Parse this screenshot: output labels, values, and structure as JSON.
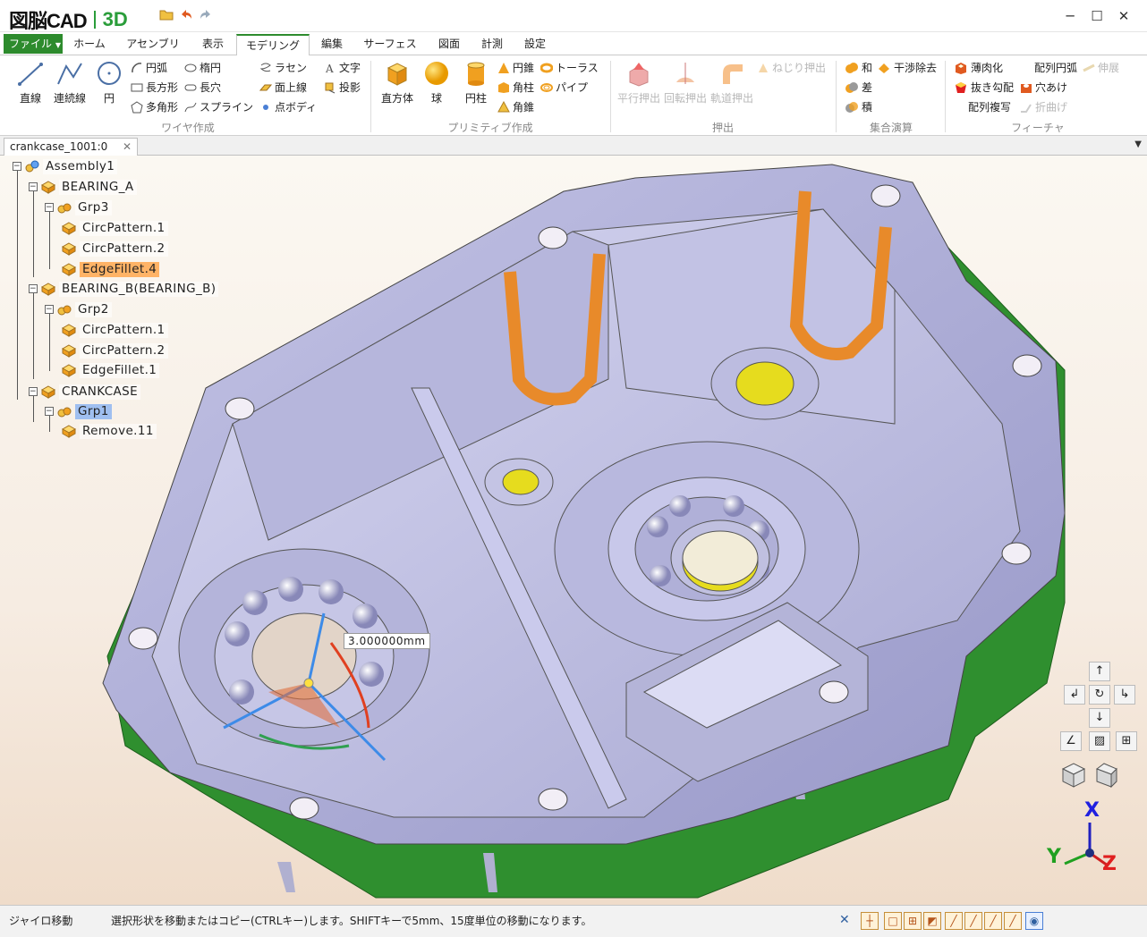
{
  "app": {
    "logo_text": "図脳CAD",
    "logo_3d": "3D"
  },
  "window_controls": {
    "minimize": "─",
    "maximize": "☐",
    "close": "✕"
  },
  "menu": {
    "file": "ファイル",
    "tabs": [
      "ホーム",
      "アセンブリ",
      "表示",
      "モデリング",
      "編集",
      "サーフェス",
      "図面",
      "計測",
      "設定"
    ],
    "active_tab": "モデリング"
  },
  "ribbon": {
    "wire": {
      "label": "ワイヤ作成",
      "line": "直線",
      "polyline": "連続線",
      "circle": "円",
      "arc": "円弧",
      "rectangle": "長方形",
      "polygon": "多角形",
      "ellipse": "楕円",
      "slot": "長穴",
      "spline": "スプライン",
      "helix": "ラセン",
      "surface_line": "面上線",
      "point_body": "点ボディ",
      "text": "文字",
      "projection": "投影"
    },
    "primitive": {
      "label": "プリミティブ作成",
      "box": "直方体",
      "sphere": "球",
      "cylinder": "円柱",
      "cone": "円錐",
      "prism": "角柱",
      "pyramid": "角錐",
      "torus": "トーラス",
      "pipe": "パイプ"
    },
    "extrude": {
      "label": "押出",
      "parallel": "平行押出",
      "revolve": "回転押出",
      "sweep": "軌道押出",
      "twist": "ねじり押出"
    },
    "boolean": {
      "label": "集合演算",
      "union": "和",
      "subtract": "差",
      "intersect": "積",
      "interference": "干渉除去"
    },
    "feature": {
      "label": "フィーチャ",
      "shell": "薄肉化",
      "draft": "抜き勾配",
      "pattern_copy": "配列複写",
      "pattern_arc": "配列円弧",
      "hole": "穴あけ",
      "fold": "折曲げ",
      "unfold": "伸展"
    }
  },
  "document": {
    "tab": "crankcase_1001:0",
    "close": "✕"
  },
  "tree": {
    "assembly": "Assembly1",
    "bearing_a": "BEARING_A",
    "grp3": "Grp3",
    "a_circ1": "CircPattern.1",
    "a_circ2": "CircPattern.2",
    "a_fillet": "EdgeFillet.4",
    "bearing_b": "BEARING_B(BEARING_B)",
    "grp2": "Grp2",
    "b_circ1": "CircPattern.1",
    "b_circ2": "CircPattern.2",
    "b_fillet": "EdgeFillet.1",
    "crankcase": "CRANKCASE",
    "grp1": "Grp1",
    "remove": "Remove.11"
  },
  "viewport": {
    "measure": "3.000000mm",
    "axis_x": "X",
    "axis_y": "Y",
    "axis_z": "Z",
    "colors": {
      "body": "#a9a9d6",
      "green_base": "#2f8f2f",
      "highlight_orange": "#e88a2a",
      "yellow": "#e6dc1e"
    }
  },
  "status": {
    "mode": "ジャイロ移動",
    "message": "選択形状を移動またはコピー(CTRLキー)します。SHIFTキーで5mm、15度単位の移動になります。"
  }
}
